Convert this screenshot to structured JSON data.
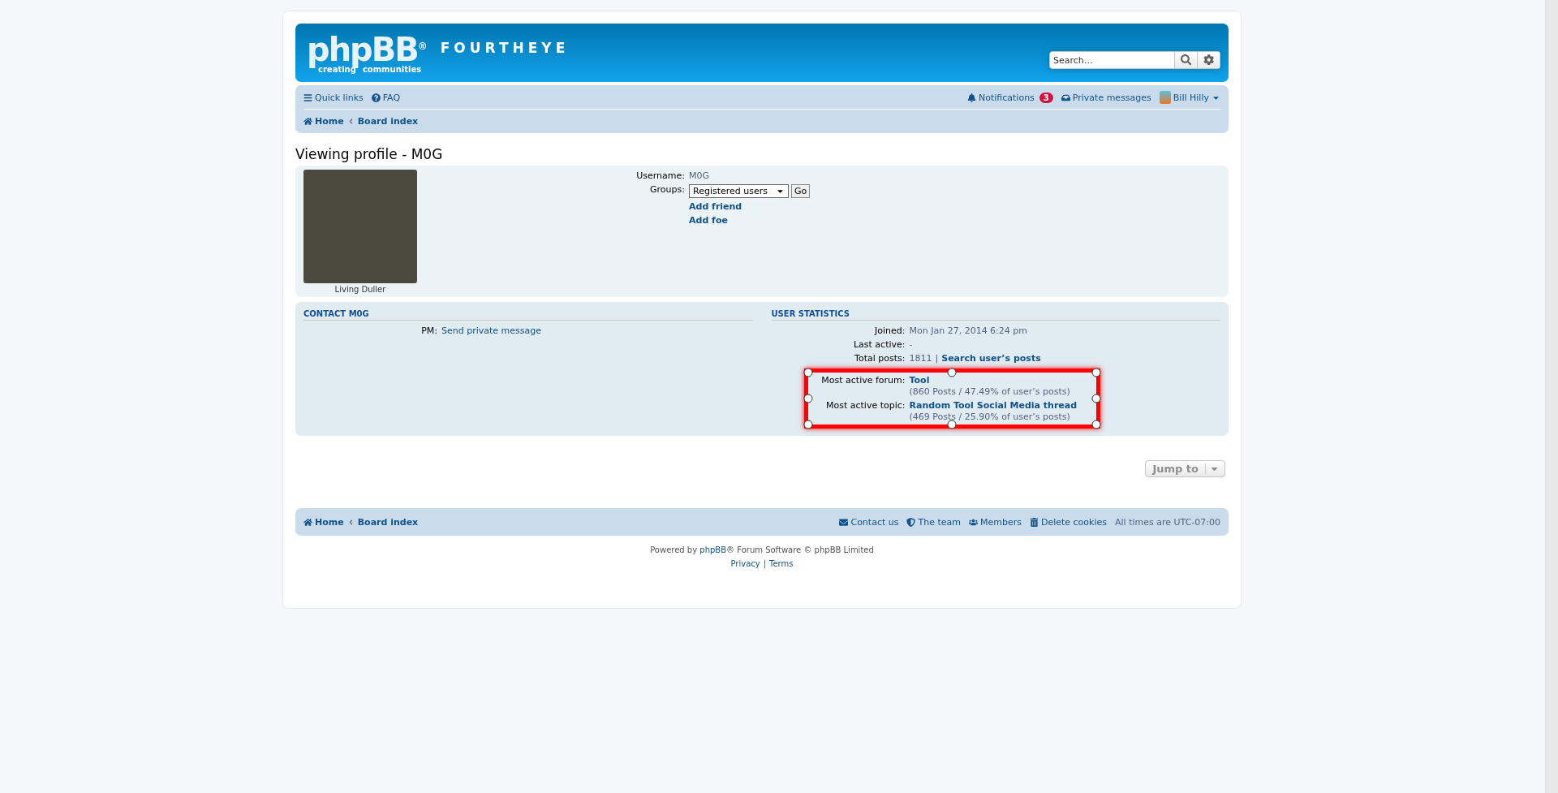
{
  "header": {
    "logo": {
      "wordmark": "phpBB",
      "mark": "®",
      "tagline": [
        "creating",
        "communities"
      ]
    },
    "site_name": "FOURTHEYE",
    "search": {
      "placeholder": "Search…"
    }
  },
  "navbar": {
    "left": [
      {
        "kind": "menu",
        "label": "Quick links"
      },
      {
        "kind": "help",
        "label": "FAQ"
      }
    ],
    "notifications": {
      "label": "Notifications",
      "count": "3"
    },
    "messages": {
      "label": "Private messages"
    },
    "user": {
      "name": "Bill Hilly"
    }
  },
  "breadcrumbs": [
    "Home",
    "Board index"
  ],
  "title": "Viewing profile - M0G",
  "profile": {
    "rank": "Living Duller",
    "username": {
      "label": "Username:",
      "value": "M0G"
    },
    "groups": {
      "label": "Groups:",
      "value": "Registered users",
      "button": "Go"
    },
    "links": [
      "Add friend",
      "Add foe"
    ]
  },
  "contact": {
    "heading": "CONTACT M0G",
    "rows": [
      {
        "label": "PM:",
        "link": "Send private message"
      }
    ]
  },
  "stats": {
    "heading": "USER STATISTICS",
    "rows": [
      {
        "label": "Joined:",
        "value": "Mon Jan 27, 2014 6:24 pm",
        "highlighted": false
      },
      {
        "label": "Last active:",
        "value": "-",
        "highlighted": false
      },
      {
        "label": "Total posts:",
        "value": "1811",
        "separator": "|",
        "link": "Search user’s posts",
        "highlighted": false
      },
      {
        "label": "Most active forum:",
        "link": "Tool",
        "note": "(860 Posts / 47.49% of user’s posts)",
        "highlighted": true
      },
      {
        "label": "Most active topic:",
        "link": "Random Tool Social Media thread",
        "note": "(469 Posts / 25.90% of user’s posts)",
        "highlighted": true
      }
    ]
  },
  "jump_to": {
    "label": "Jump to"
  },
  "footer_nav": {
    "breadcrumbs": [
      "Home",
      "Board index"
    ],
    "links": [
      {
        "kind": "contact",
        "label": "Contact us"
      },
      {
        "kind": "team",
        "label": "The team"
      },
      {
        "kind": "members",
        "label": "Members"
      },
      {
        "kind": "cookies",
        "label": "Delete cookies"
      }
    ],
    "timezone": "All times are UTC-07:00"
  },
  "credits": {
    "prefix": "Powered by",
    "link": "phpBB",
    "suffix": "® Forum Software © phpBB Limited",
    "links": [
      "Privacy",
      "Terms"
    ],
    "separator": "|"
  }
}
